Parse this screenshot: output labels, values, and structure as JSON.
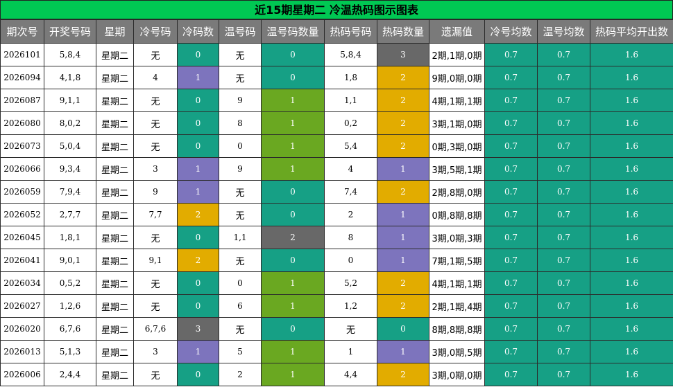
{
  "title": "近15期星期二 冷温热码图示图表",
  "headers": [
    "期次号",
    "开奖号码",
    "星期",
    "冷号码",
    "冷码数",
    "温号码",
    "温号码数量",
    "热码号码",
    "热码数量",
    "遗漏值",
    "冷号均数",
    "温号均数",
    "热码平均开出数"
  ],
  "rows": [
    {
      "issue": "2026101",
      "numbers": "5,8,4",
      "weekday": "星期二",
      "cold": "无",
      "cold_n": "0",
      "warm": "无",
      "warm_n": "0",
      "hot": "5,8,4",
      "hot_n": "3",
      "miss": "2期,1期,0期",
      "cold_avg": "0.7",
      "warm_avg": "0.7",
      "hot_avg": "1.6"
    },
    {
      "issue": "2026094",
      "numbers": "4,1,8",
      "weekday": "星期二",
      "cold": "4",
      "cold_n": "1",
      "warm": "无",
      "warm_n": "0",
      "hot": "1,8",
      "hot_n": "2",
      "miss": "9期,0期,0期",
      "cold_avg": "0.7",
      "warm_avg": "0.7",
      "hot_avg": "1.6"
    },
    {
      "issue": "2026087",
      "numbers": "9,1,1",
      "weekday": "星期二",
      "cold": "无",
      "cold_n": "0",
      "warm": "9",
      "warm_n": "1",
      "hot": "1,1",
      "hot_n": "2",
      "miss": "4期,1期,1期",
      "cold_avg": "0.7",
      "warm_avg": "0.7",
      "hot_avg": "1.6"
    },
    {
      "issue": "2026080",
      "numbers": "8,0,2",
      "weekday": "星期二",
      "cold": "无",
      "cold_n": "0",
      "warm": "8",
      "warm_n": "1",
      "hot": "0,2",
      "hot_n": "2",
      "miss": "3期,1期,0期",
      "cold_avg": "0.7",
      "warm_avg": "0.7",
      "hot_avg": "1.6"
    },
    {
      "issue": "2026073",
      "numbers": "5,0,4",
      "weekday": "星期二",
      "cold": "无",
      "cold_n": "0",
      "warm": "0",
      "warm_n": "1",
      "hot": "5,4",
      "hot_n": "2",
      "miss": "0期,3期,0期",
      "cold_avg": "0.7",
      "warm_avg": "0.7",
      "hot_avg": "1.6"
    },
    {
      "issue": "2026066",
      "numbers": "9,3,4",
      "weekday": "星期二",
      "cold": "3",
      "cold_n": "1",
      "warm": "9",
      "warm_n": "1",
      "hot": "4",
      "hot_n": "1",
      "miss": "3期,5期,1期",
      "cold_avg": "0.7",
      "warm_avg": "0.7",
      "hot_avg": "1.6"
    },
    {
      "issue": "2026059",
      "numbers": "7,9,4",
      "weekday": "星期二",
      "cold": "9",
      "cold_n": "1",
      "warm": "无",
      "warm_n": "0",
      "hot": "7,4",
      "hot_n": "2",
      "miss": "2期,8期,0期",
      "cold_avg": "0.7",
      "warm_avg": "0.7",
      "hot_avg": "1.6"
    },
    {
      "issue": "2026052",
      "numbers": "2,7,7",
      "weekday": "星期二",
      "cold": "7,7",
      "cold_n": "2",
      "warm": "无",
      "warm_n": "0",
      "hot": "2",
      "hot_n": "1",
      "miss": "0期,8期,8期",
      "cold_avg": "0.7",
      "warm_avg": "0.7",
      "hot_avg": "1.6"
    },
    {
      "issue": "2026045",
      "numbers": "1,8,1",
      "weekday": "星期二",
      "cold": "无",
      "cold_n": "0",
      "warm": "1,1",
      "warm_n": "2",
      "hot": "8",
      "hot_n": "1",
      "miss": "3期,0期,3期",
      "cold_avg": "0.7",
      "warm_avg": "0.7",
      "hot_avg": "1.6"
    },
    {
      "issue": "2026041",
      "numbers": "9,0,1",
      "weekday": "星期二",
      "cold": "9,1",
      "cold_n": "2",
      "warm": "无",
      "warm_n": "0",
      "hot": "0",
      "hot_n": "1",
      "miss": "7期,1期,5期",
      "cold_avg": "0.7",
      "warm_avg": "0.7",
      "hot_avg": "1.6"
    },
    {
      "issue": "2026034",
      "numbers": "0,5,2",
      "weekday": "星期二",
      "cold": "无",
      "cold_n": "0",
      "warm": "0",
      "warm_n": "1",
      "hot": "5,2",
      "hot_n": "2",
      "miss": "4期,1期,1期",
      "cold_avg": "0.7",
      "warm_avg": "0.7",
      "hot_avg": "1.6"
    },
    {
      "issue": "2026027",
      "numbers": "1,2,6",
      "weekday": "星期二",
      "cold": "无",
      "cold_n": "0",
      "warm": "6",
      "warm_n": "1",
      "hot": "1,2",
      "hot_n": "2",
      "miss": "2期,1期,4期",
      "cold_avg": "0.7",
      "warm_avg": "0.7",
      "hot_avg": "1.6"
    },
    {
      "issue": "2026020",
      "numbers": "6,7,6",
      "weekday": "星期二",
      "cold": "6,7,6",
      "cold_n": "3",
      "warm": "无",
      "warm_n": "0",
      "hot": "无",
      "hot_n": "0",
      "miss": "8期,8期,8期",
      "cold_avg": "0.7",
      "warm_avg": "0.7",
      "hot_avg": "1.6"
    },
    {
      "issue": "2026013",
      "numbers": "5,1,3",
      "weekday": "星期二",
      "cold": "3",
      "cold_n": "1",
      "warm": "5",
      "warm_n": "1",
      "hot": "1",
      "hot_n": "1",
      "miss": "3期,0期,5期",
      "cold_avg": "0.7",
      "warm_avg": "0.7",
      "hot_avg": "1.6"
    },
    {
      "issue": "2026006",
      "numbers": "2,4,4",
      "weekday": "星期二",
      "cold": "无",
      "cold_n": "0",
      "warm": "2",
      "warm_n": "1",
      "hot": "4,4",
      "hot_n": "2",
      "miss": "3期,0期,0期",
      "cold_avg": "0.7",
      "warm_avg": "0.7",
      "hot_avg": "1.6"
    }
  ],
  "colors": {
    "title_bg": "#00c853",
    "header_bg": "#7a7a7a",
    "teal": "#16a085",
    "purple": "#7d74bd",
    "orange": "#e2ac00",
    "gray": "#686868",
    "green": "#6aa821"
  }
}
